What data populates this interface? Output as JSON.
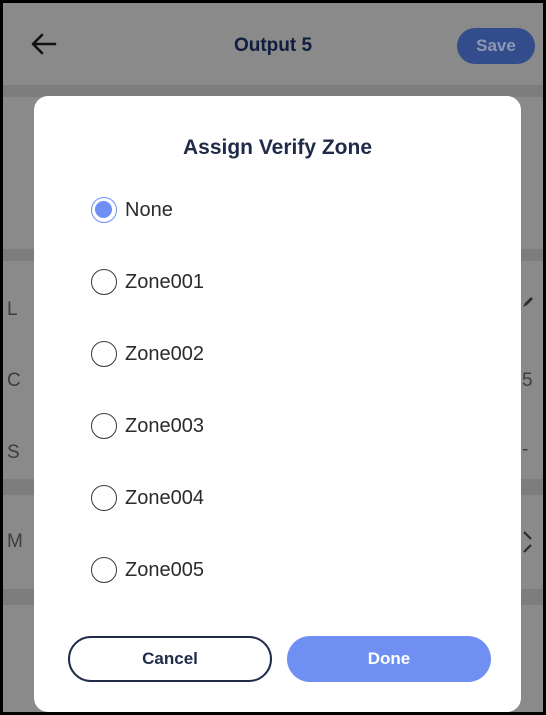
{
  "header": {
    "title": "Output 5",
    "save_label": "Save"
  },
  "background": {
    "row_letters": [
      "L",
      "C",
      "S",
      "M"
    ],
    "right_values": [
      "5",
      "-"
    ]
  },
  "dialog": {
    "title": "Assign Verify Zone",
    "options": [
      {
        "label": "None",
        "selected": true
      },
      {
        "label": "Zone001",
        "selected": false
      },
      {
        "label": "Zone002",
        "selected": false
      },
      {
        "label": "Zone003",
        "selected": false
      },
      {
        "label": "Zone004",
        "selected": false
      },
      {
        "label": "Zone005",
        "selected": false
      }
    ],
    "cancel_label": "Cancel",
    "done_label": "Done"
  },
  "colors": {
    "accent": "#6f8ff2",
    "title_text": "#1f2b49",
    "overlay": "#8a8a8a"
  }
}
